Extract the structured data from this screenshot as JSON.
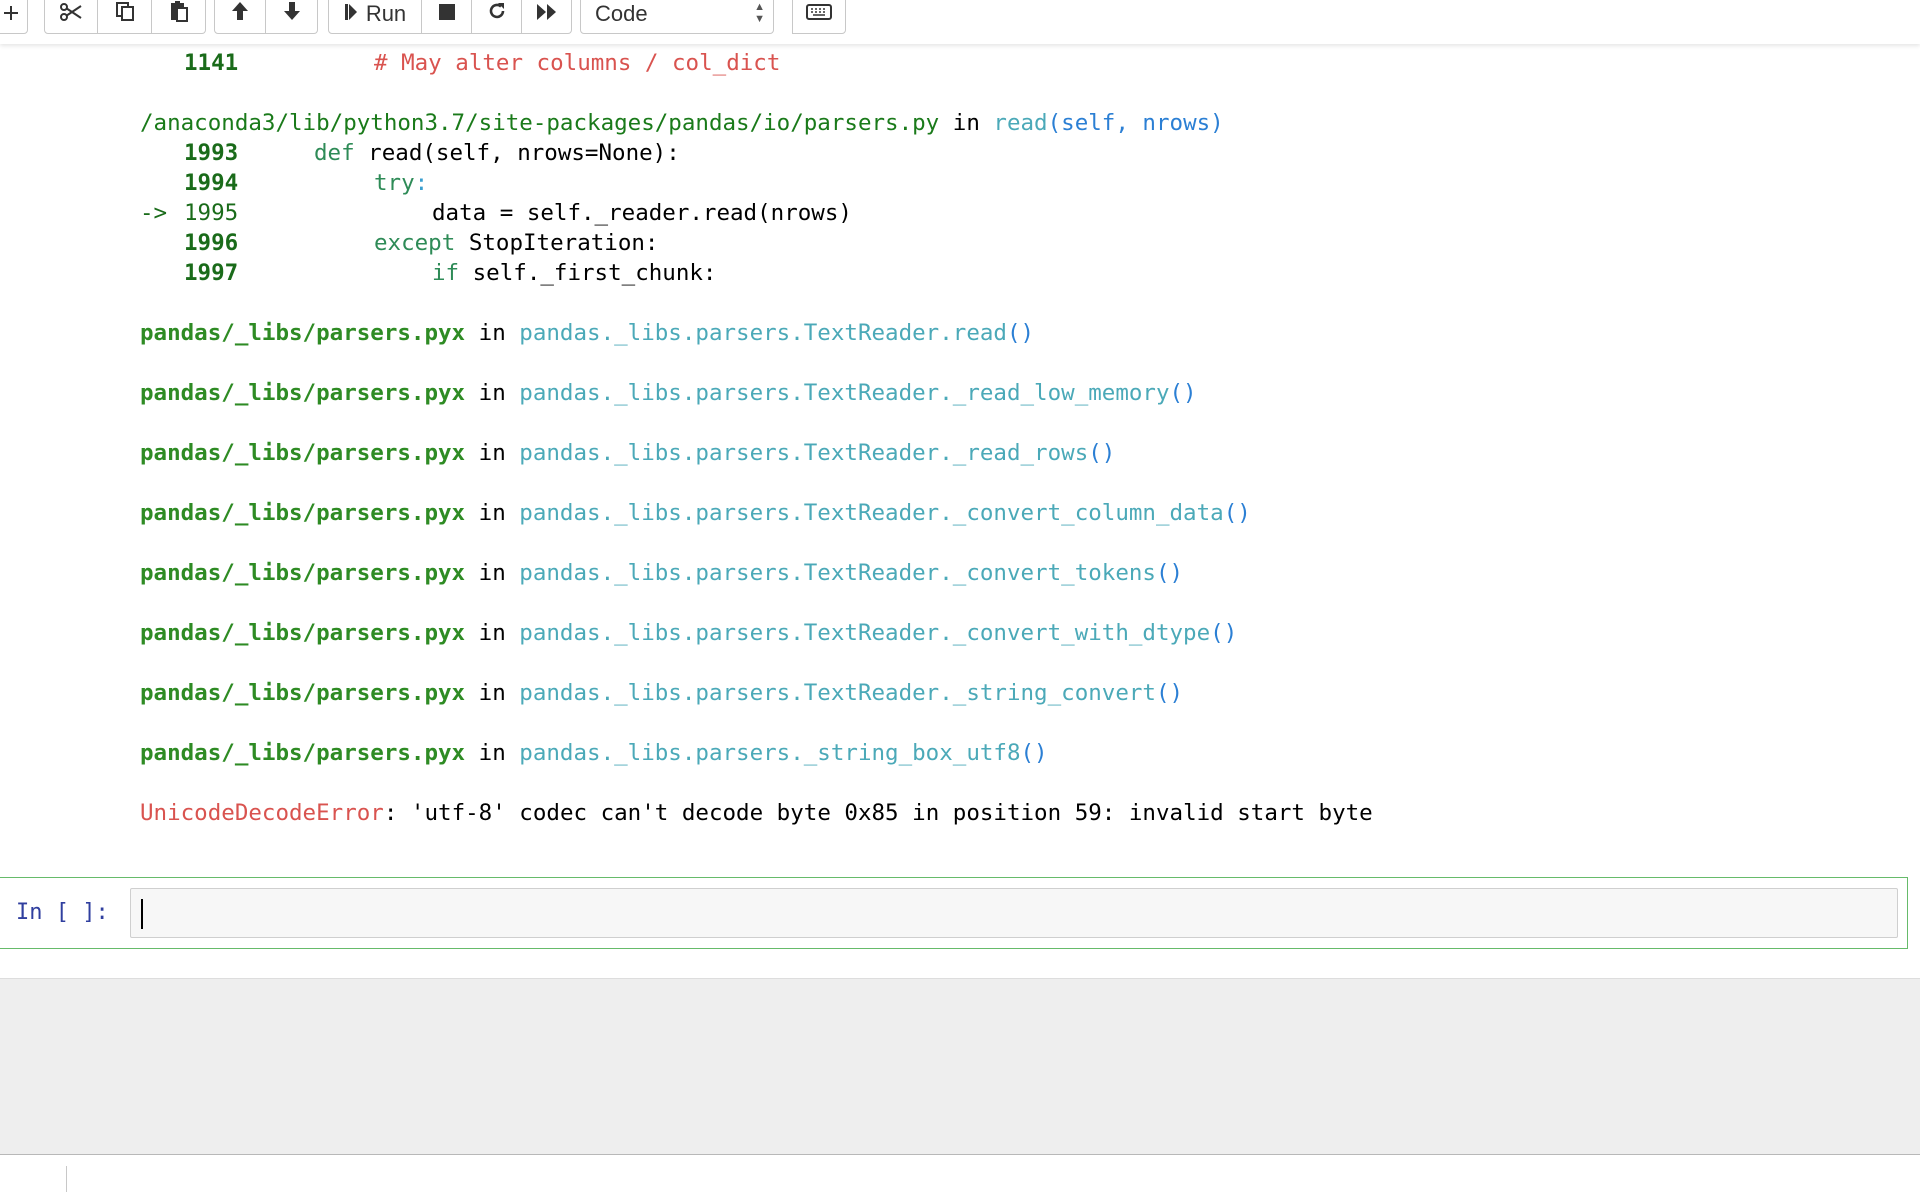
{
  "toolbar": {
    "run_label": "Run",
    "cell_type": "Code"
  },
  "traceback": {
    "frame0": {
      "lineno": "1141",
      "comment": "# May alter columns / col_dict"
    },
    "frame1": {
      "path": "/anaconda3/lib/python3.7/site-packages/pandas/io/parsers.py",
      "in": "in",
      "func": "read",
      "args": "(self, nrows)",
      "lines": [
        {
          "no": "1993",
          "arrow": "",
          "code_kw": "def",
          "code_rest": " read(self, nrows=None):"
        },
        {
          "no": "1994",
          "arrow": "",
          "code_kw": "try",
          "code_rest": ":"
        },
        {
          "no": "1995",
          "arrow": "->",
          "code_kw": "",
          "code_rest": "data = self._reader.read(nrows)"
        },
        {
          "no": "1996",
          "arrow": "",
          "code_kw": "except",
          "code_rest": " StopIteration:"
        },
        {
          "no": "1997",
          "arrow": "",
          "code_kw": "if",
          "code_rest": " self._first_chunk:"
        }
      ]
    },
    "pyx_frames": [
      {
        "file": "pandas/_libs/parsers.pyx",
        "in": "in",
        "func": "pandas._libs.parsers.TextReader.read",
        "parens": "()"
      },
      {
        "file": "pandas/_libs/parsers.pyx",
        "in": "in",
        "func": "pandas._libs.parsers.TextReader._read_low_memory",
        "parens": "()"
      },
      {
        "file": "pandas/_libs/parsers.pyx",
        "in": "in",
        "func": "pandas._libs.parsers.TextReader._read_rows",
        "parens": "()"
      },
      {
        "file": "pandas/_libs/parsers.pyx",
        "in": "in",
        "func": "pandas._libs.parsers.TextReader._convert_column_data",
        "parens": "()"
      },
      {
        "file": "pandas/_libs/parsers.pyx",
        "in": "in",
        "func": "pandas._libs.parsers.TextReader._convert_tokens",
        "parens": "()"
      },
      {
        "file": "pandas/_libs/parsers.pyx",
        "in": "in",
        "func": "pandas._libs.parsers.TextReader._convert_with_dtype",
        "parens": "()"
      },
      {
        "file": "pandas/_libs/parsers.pyx",
        "in": "in",
        "func": "pandas._libs.parsers.TextReader._string_convert",
        "parens": "()"
      },
      {
        "file": "pandas/_libs/parsers.pyx",
        "in": "in",
        "func": "pandas._libs.parsers._string_box_utf8",
        "parens": "()"
      }
    ],
    "error_type": "UnicodeDecodeError",
    "error_message": ": 'utf-8' codec can't decode byte 0x85 in position 59: invalid start byte"
  },
  "input_cell": {
    "prompt": "In [ ]:",
    "value": ""
  },
  "colors": {
    "cell_border": "#66bb6a",
    "prompt": "#303f9f",
    "error": "#d9534f"
  }
}
